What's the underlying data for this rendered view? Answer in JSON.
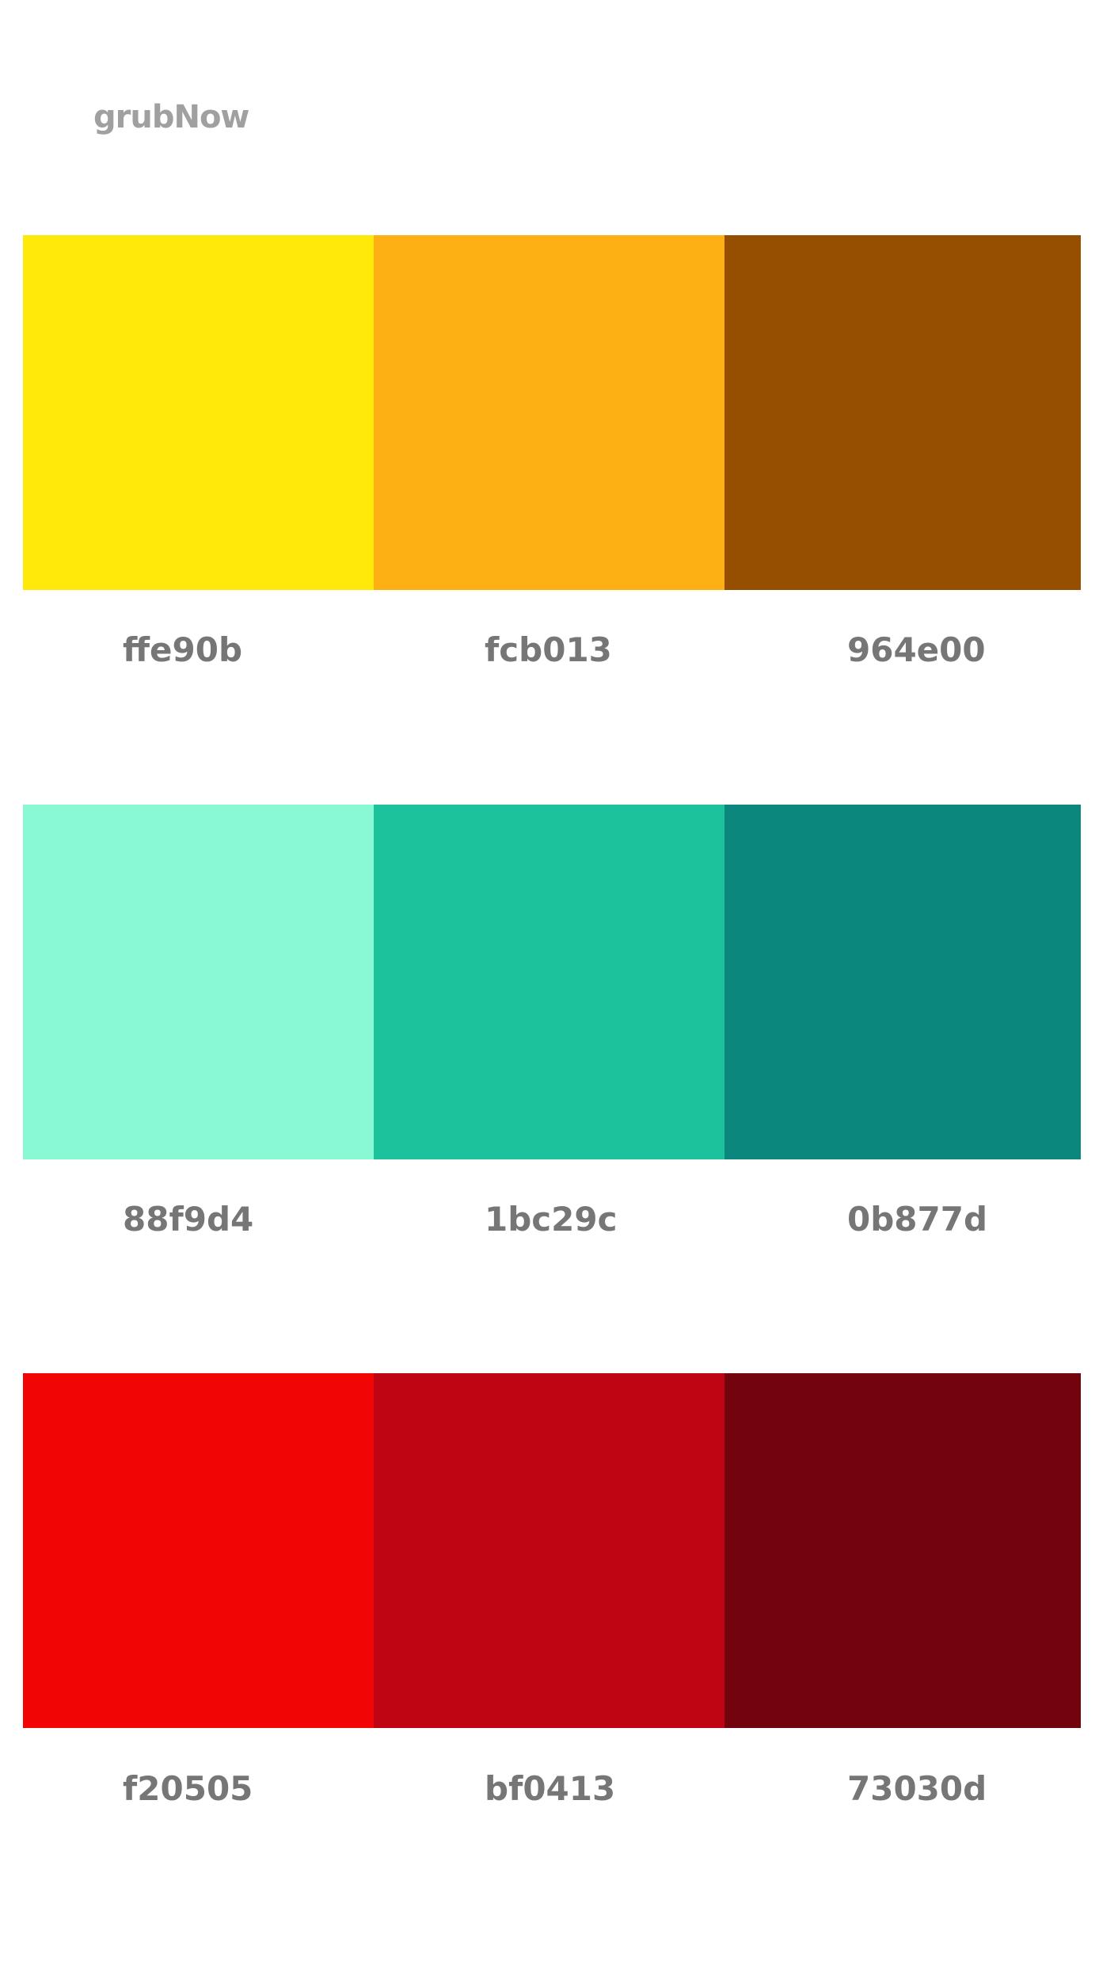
{
  "brand": {
    "name": "grubNow"
  },
  "palette": {
    "rows": [
      {
        "swatches": [
          {
            "hex_label": "ffe90b",
            "color": "#ffe90b"
          },
          {
            "hex_label": "fcb013",
            "color": "#fcb013"
          },
          {
            "hex_label": "964e00",
            "color": "#964e00"
          }
        ]
      },
      {
        "swatches": [
          {
            "hex_label": "88f9d4",
            "color": "#88f9d4"
          },
          {
            "hex_label": "1bc29c",
            "color": "#1bc29c"
          },
          {
            "hex_label": "0b877d",
            "color": "#0b877d"
          }
        ]
      },
      {
        "swatches": [
          {
            "hex_label": "f20505",
            "color": "#f20505"
          },
          {
            "hex_label": "bf0413",
            "color": "#bf0413"
          },
          {
            "hex_label": "73030d",
            "color": "#73030d"
          }
        ]
      }
    ]
  },
  "colors": {
    "label_text": "#767676",
    "logo_text": "#a0a0a0",
    "background": "#ffffff"
  }
}
